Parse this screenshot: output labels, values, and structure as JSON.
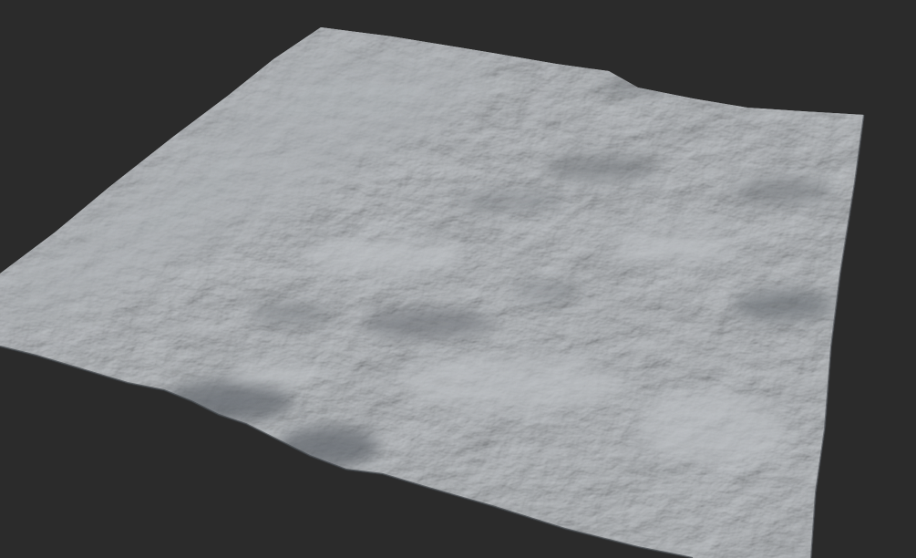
{
  "viewport": {
    "background_color": "#2b2b2b",
    "subject": "terrain-heightmap-mesh"
  },
  "terrain": {
    "base_color": "#a9adb1",
    "light_color": "#c6c9cc",
    "shadow_color": "#3c4046"
  }
}
